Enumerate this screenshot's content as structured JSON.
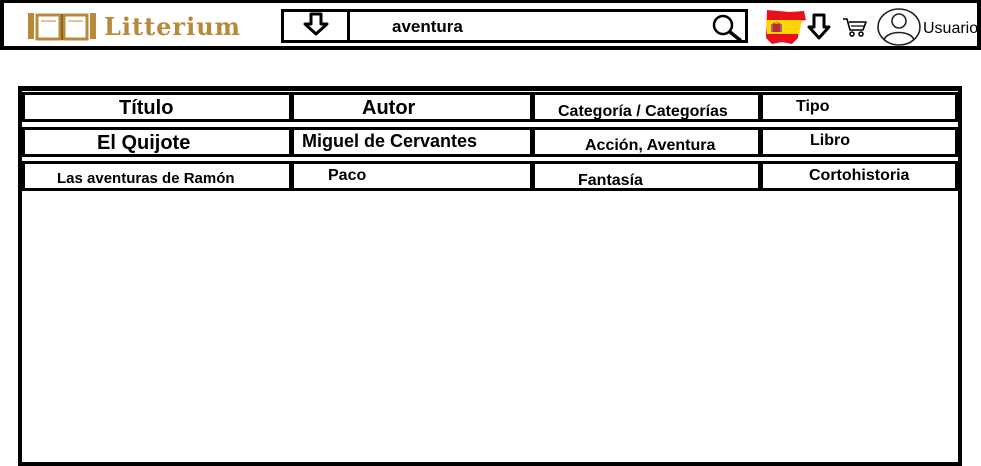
{
  "brand": {
    "name": "Litterium",
    "logo_icon": "open-book-icon",
    "color": "#b8893a"
  },
  "search": {
    "dropdown_icon": "arrow-down-icon",
    "value": "aventura",
    "submit_icon": "search-icon"
  },
  "language": {
    "flag_icon": "spain-flag-icon",
    "dropdown_icon": "arrow-down-icon"
  },
  "cart": {
    "icon": "cart-icon"
  },
  "user": {
    "icon": "user-avatar-icon",
    "label": "Usuario"
  },
  "table": {
    "headers": [
      "Título",
      "Autor",
      "Categoría / Categorías",
      "Tipo"
    ],
    "rows": [
      [
        "El Quijote",
        "Miguel de Cervantes",
        "Acción, Aventura",
        "Libro"
      ],
      [
        "Las aventuras de Ramón",
        "Paco",
        "Fantasía",
        "Cortohistoria"
      ]
    ]
  }
}
